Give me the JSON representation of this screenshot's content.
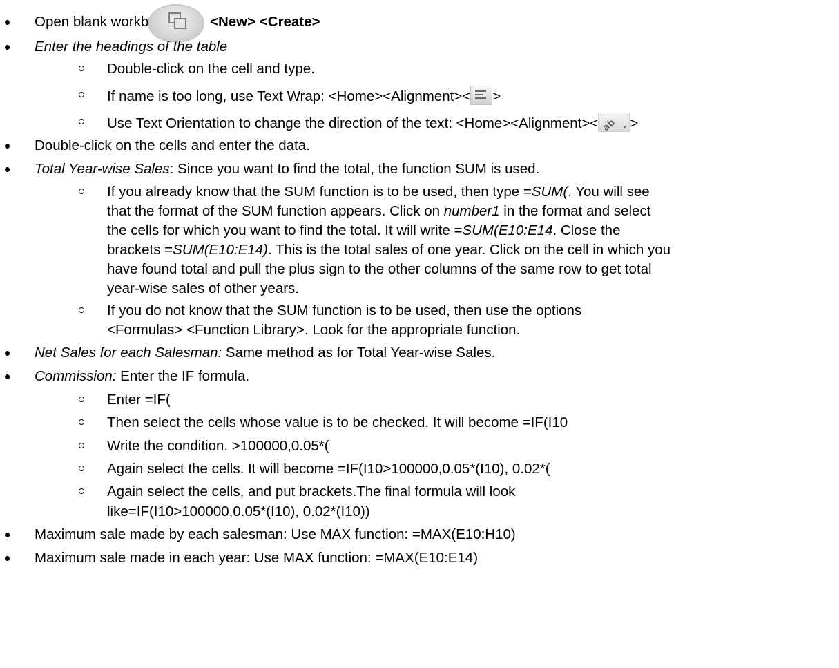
{
  "items": {
    "open": {
      "text": "Open blank workbook.",
      "bold": "<New> <Create>"
    },
    "headings": {
      "text": "Enter the headings of the table"
    },
    "headings_sub1": {
      "text": "Double-click on the cell and type."
    },
    "headings_sub2": {
      "pre": "If name is too long, use Text Wrap: <Home><Alignment><",
      "post": ">"
    },
    "headings_sub3": {
      "pre": "Use Text Orientation to change the direction of the text: <Home><Alignment><",
      "post": ">"
    },
    "dblclick": {
      "text": "Double-click on the cells and enter the data."
    },
    "total": {
      "label": "Total Year-wise Sales",
      "text": ": Since you want to find the total, the function SUM is used."
    },
    "total_sub1": {
      "l1a": "If you already know that the SUM function is to be used, then type =",
      "l1b": "SUM(",
      "l1c": ". You will see",
      "l2": "that the format of the SUM function appears. Click on ",
      "l2b": "number1",
      "l2c": " in the format and select",
      "l3a": "the cells for which you want to find the total. It will write =",
      "l3b": "SUM(E10:E14",
      "l3c": ". Close the",
      "l4a": "brackets =",
      "l4b": "SUM(E10:E14)",
      "l4c": ". This is the total sales of one year. Click on the cell in which you",
      "l5": "have found total and pull the plus sign to the other columns of the same row to get total",
      "l6": "year-wise sales of other years."
    },
    "total_sub2": {
      "l1": "If you do not know that the SUM function is to be used, then use the options",
      "l2": "<Formulas> <Function Library>. Look for the appropriate function."
    },
    "net": {
      "label": "Net Sales for each Salesman:",
      "text": " Same method as for Total Year-wise Sales."
    },
    "commission": {
      "label": "Commission:",
      "text": " Enter the IF formula."
    },
    "commission_sub1": {
      "text": "Enter =IF("
    },
    "commission_sub2": {
      "text": "Then select the cells whose value is to be checked. It will become =IF(I10"
    },
    "commission_sub3": {
      "text": "Write the condition. >100000,0.05*("
    },
    "commission_sub4": {
      "text": "Again select the cells. It will become =IF(I10>100000,0.05*(I10), 0.02*("
    },
    "commission_sub5": {
      "l1": "Again select the cells, and put brackets.The final formula will look",
      "l2": "like=IF(I10>100000,0.05*(I10), 0.02*(I10))"
    },
    "max_salesman": {
      "text": "Maximum sale made by each salesman: Use MAX function: =MAX(E10:H10)"
    },
    "max_year": {
      "text": "Maximum sale made in each year: Use MAX function: =MAX(E10:E14)"
    }
  },
  "icons": {
    "office": "office-button-icon",
    "wrap": "wrap-text-icon",
    "orientation": "text-orientation-icon"
  }
}
